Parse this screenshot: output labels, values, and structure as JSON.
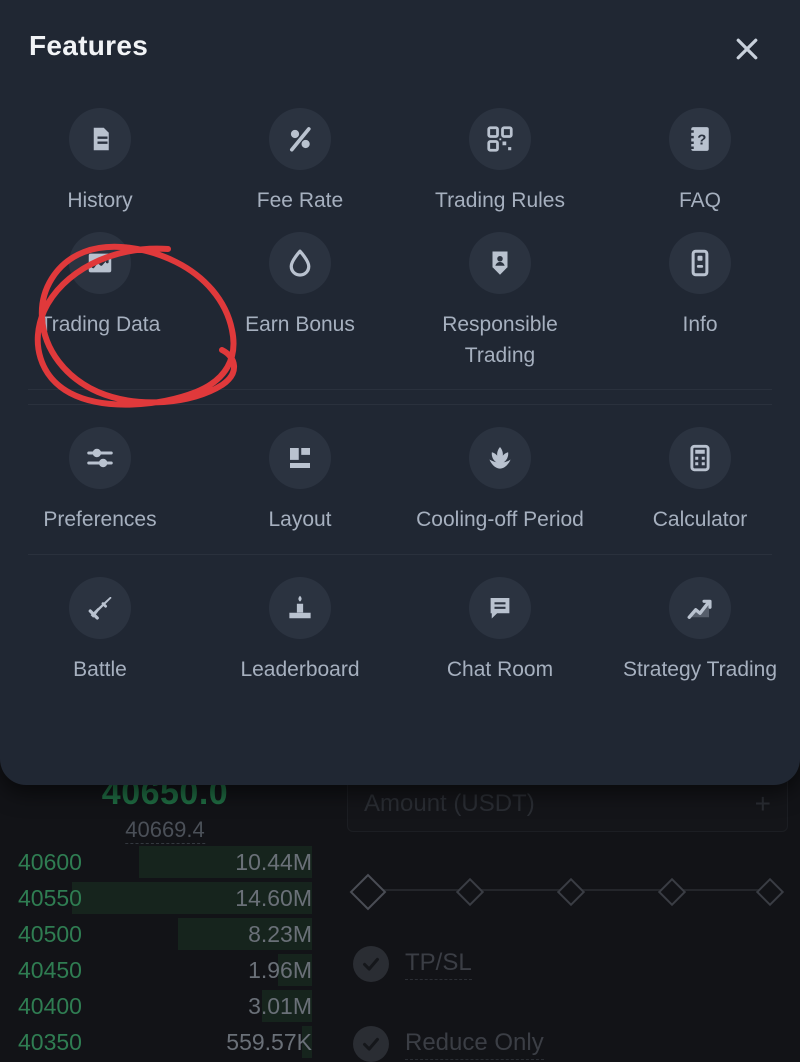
{
  "sheet": {
    "title": "Features",
    "close_icon": "close-icon",
    "rows": [
      {
        "items": [
          {
            "label": "History",
            "icon": "document-icon"
          },
          {
            "label": "Fee Rate",
            "icon": "percent-icon"
          },
          {
            "label": "Trading Rules",
            "icon": "grid-qr-icon"
          },
          {
            "label": "FAQ",
            "icon": "question-book-icon"
          }
        ]
      },
      {
        "items": [
          {
            "label": "Trading Data",
            "icon": "chart-line-icon"
          },
          {
            "label": "Earn Bonus",
            "icon": "droplet-icon"
          },
          {
            "label": "Responsible Trading",
            "icon": "shield-person-icon"
          },
          {
            "label": "Info",
            "icon": "info-card-icon"
          }
        ]
      },
      {
        "items": [
          {
            "label": "Preferences",
            "icon": "sliders-icon"
          },
          {
            "label": "Layout",
            "icon": "layout-panels-icon"
          },
          {
            "label": "Cooling-off Period",
            "icon": "lotus-icon"
          },
          {
            "label": "Calculator",
            "icon": "calculator-icon"
          }
        ]
      },
      {
        "items": [
          {
            "label": "Battle",
            "icon": "sword-icon"
          },
          {
            "label": "Leaderboard",
            "icon": "podium-icon"
          },
          {
            "label": "Chat Room",
            "icon": "chat-bubble-icon"
          },
          {
            "label": "Strategy Trading",
            "icon": "trend-up-icon"
          }
        ]
      }
    ]
  },
  "background": {
    "price_last": "40650.0",
    "price_index": "40669.4",
    "orderbook": [
      {
        "price": "40600",
        "amount": "10.44M",
        "depth_pct": 72
      },
      {
        "price": "40550",
        "amount": "14.60M",
        "depth_pct": 100
      },
      {
        "price": "40500",
        "amount": "8.23M",
        "depth_pct": 56
      },
      {
        "price": "40450",
        "amount": "1.96M",
        "depth_pct": 14
      },
      {
        "price": "40400",
        "amount": "3.01M",
        "depth_pct": 21
      },
      {
        "price": "40350",
        "amount": "559.57K",
        "depth_pct": 4
      }
    ],
    "amount_field": {
      "label": "Amount (USDT)",
      "plus_label": "+"
    },
    "checkboxes": [
      {
        "label": "TP/SL",
        "checked": true
      },
      {
        "label": "Reduce Only",
        "checked": true
      }
    ]
  },
  "annotation": {
    "type": "hand-drawn-circle",
    "color": "#e0393b",
    "target": "Trading Data"
  },
  "colors": {
    "sheet_bg": "#202733",
    "page_bg": "#121317",
    "icon_circle": "#2b3340",
    "icon_glyph": "#b9c2cf",
    "label": "#a6b0bf",
    "title": "#f1f3f6",
    "bid_green": "#2f7d52",
    "annotation_red": "#e0393b"
  }
}
